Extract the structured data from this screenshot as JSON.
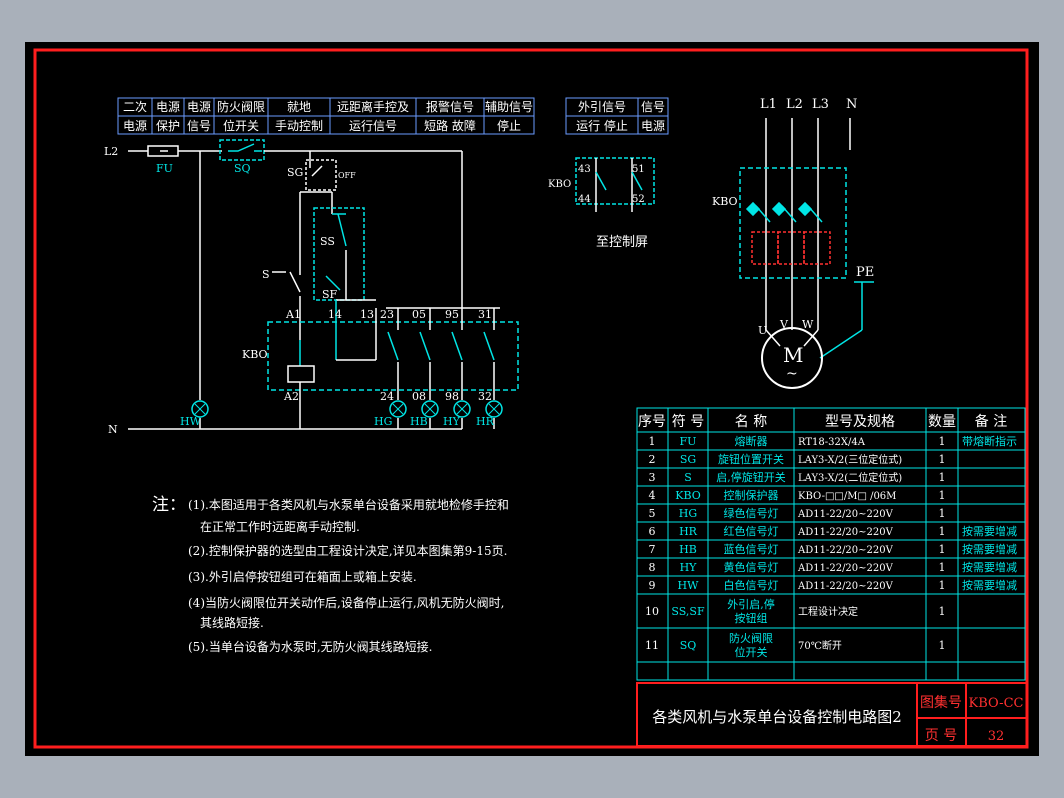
{
  "header_groups": [
    {
      "top": "二次",
      "bottom": "电源"
    },
    {
      "top": "电源",
      "bottom": "保护"
    },
    {
      "top": "电源",
      "bottom": "信号"
    },
    {
      "top": "防火阀限",
      "bottom": "位开关"
    },
    {
      "top": "就地",
      "bottom": "手动控制"
    },
    {
      "top": "远距离手控及",
      "bottom": "运行信号"
    },
    {
      "top": "报警信号",
      "bottom": "短路 故障"
    },
    {
      "top": "辅助信号",
      "bottom": "停止"
    }
  ],
  "ext_header": [
    {
      "top": "外引信号",
      "bottom": "运行 停止"
    },
    {
      "top": "信号",
      "bottom": "电源"
    }
  ],
  "labels": {
    "l2": "L2",
    "n": "N",
    "fu": "FU",
    "sq": "SQ",
    "sg": "SG",
    "off": "OFF",
    "ss": "SS",
    "s": "S",
    "sf": "SF",
    "kbo": "KBO",
    "a1": "A1",
    "a2": "A2",
    "t14": "14",
    "t13": "13",
    "t23": "23",
    "t05": "05",
    "t95": "95",
    "t31": "31",
    "t24": "24",
    "t08": "08",
    "t98": "98",
    "t32": "32",
    "hw": "HW",
    "hg": "HG",
    "hb": "HB",
    "hy": "HY",
    "hr": "HR",
    "c43": "43",
    "c44": "44",
    "c51": "51",
    "c52": "52",
    "to_ctrl": "至控制屏",
    "L1": "L1",
    "Lb2": "L2",
    "L3": "L3",
    "N2": "N",
    "pe": "PE",
    "u": "U",
    "v": "V",
    "wv": "W",
    "m": "M",
    "tilde": "~"
  },
  "notes": {
    "prefix": "注：",
    "items": [
      "(1).本图适用于各类风机与水泵单台设备采用就地检修手控和",
      "在正常工作时远距离手动控制.",
      "(2).控制保护器的选型由工程设计决定,详见本图集第9-15页.",
      "(3).外引启停按钮组可在箱面上或箱上安装.",
      "(4)当防火阀限位开关动作后,设备停止运行,风机无防火阀时,",
      "其线路短接.",
      "(5).当单台设备为水泵时,无防火阀其线路短接."
    ]
  },
  "table": {
    "headers": [
      "序号",
      "符 号",
      "名 称",
      "型号及规格",
      "数量",
      "备 注"
    ],
    "rows": [
      [
        "1",
        "FU",
        "熔断器",
        "RT18-32X/4A",
        "1",
        "带熔断指示"
      ],
      [
        "2",
        "SG",
        "旋钮位置开关",
        "LAY3-X/2(三位定位式)",
        "1",
        ""
      ],
      [
        "3",
        "S",
        "启,停旋钮开关",
        "LAY3-X/2(二位定位式)",
        "1",
        ""
      ],
      [
        "4",
        "KBO",
        "控制保护器",
        "KBO-□□/M□ /06M",
        "1",
        ""
      ],
      [
        "5",
        "HG",
        "绿色信号灯",
        "AD11-22/20~220V",
        "1",
        ""
      ],
      [
        "6",
        "HR",
        "红色信号灯",
        "AD11-22/20~220V",
        "1",
        "按需要增减"
      ],
      [
        "7",
        "HB",
        "蓝色信号灯",
        "AD11-22/20~220V",
        "1",
        "按需要增减"
      ],
      [
        "8",
        "HY",
        "黄色信号灯",
        "AD11-22/20~220V",
        "1",
        "按需要增减"
      ],
      [
        "9",
        "HW",
        "白色信号灯",
        "AD11-22/20~220V",
        "1",
        "按需要增减"
      ],
      [
        "10",
        "SS,SF",
        "外引启,停\n按钮组",
        "工程设计决定",
        "1",
        ""
      ],
      [
        "11",
        "SQ",
        "防火阀限\n位开关",
        "70℃断开",
        "1",
        ""
      ]
    ]
  },
  "title_block": {
    "title": "各类风机与水泵单台设备控制电路图2",
    "atlas_label": "图集号",
    "atlas_value": "KBO-CC",
    "page_label": "页 号",
    "page_value": "32"
  }
}
